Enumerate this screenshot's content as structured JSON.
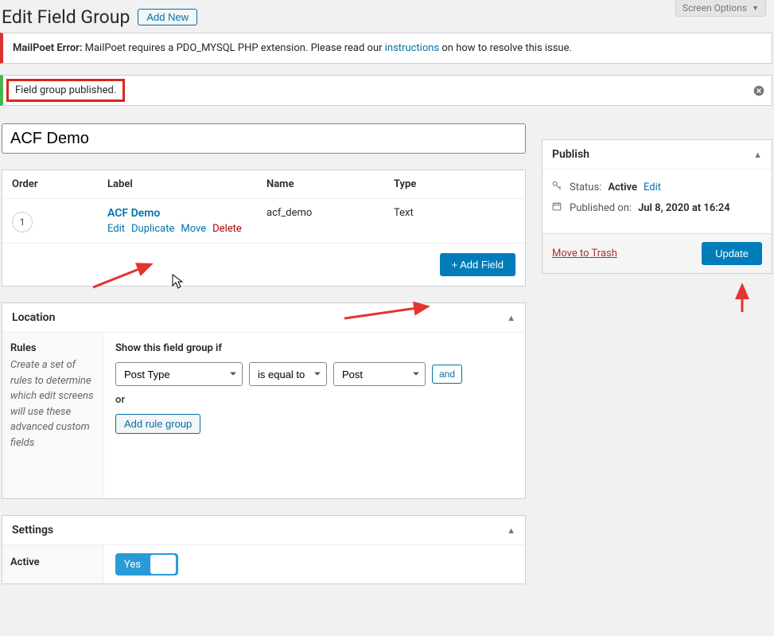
{
  "screen_options": "Screen Options",
  "page_title": "Edit Field Group",
  "add_new": "Add New",
  "mailpoet": {
    "prefix": "MailPoet Error:",
    "msg_before": " MailPoet requires a PDO_MYSQL PHP extension. Please read our ",
    "link": "instructions",
    "msg_after": " on how to resolve this issue."
  },
  "published_notice": "Field group published.",
  "title_input_value": "ACF Demo",
  "fields": {
    "headers": {
      "order": "Order",
      "label": "Label",
      "name": "Name",
      "type": "Type"
    },
    "row": {
      "order": "1",
      "label": "ACF Demo",
      "name": "acf_demo",
      "type": "Text",
      "actions": {
        "edit": "Edit",
        "duplicate": "Duplicate",
        "move": "Move",
        "delete": "Delete"
      }
    },
    "add_field": "+ Add Field"
  },
  "location": {
    "title": "Location",
    "rules_title": "Rules",
    "rules_desc": "Create a set of rules to determine which edit screens will use these advanced custom fields",
    "show_if": "Show this field group if",
    "param": "Post Type",
    "operator": "is equal to",
    "value": "Post",
    "and": "and",
    "or": "or",
    "add_rule_group": "Add rule group"
  },
  "settings": {
    "title": "Settings",
    "active_label": "Active",
    "toggle_yes": "Yes"
  },
  "publish": {
    "title": "Publish",
    "status_label": "Status:",
    "status_value": "Active",
    "status_edit": "Edit",
    "pub_label": "Published on:",
    "pub_value": "Jul 8, 2020 at 16:24",
    "trash": "Move to Trash",
    "update": "Update"
  },
  "colors": {
    "accent": "#007cba",
    "danger": "#d8261c"
  }
}
